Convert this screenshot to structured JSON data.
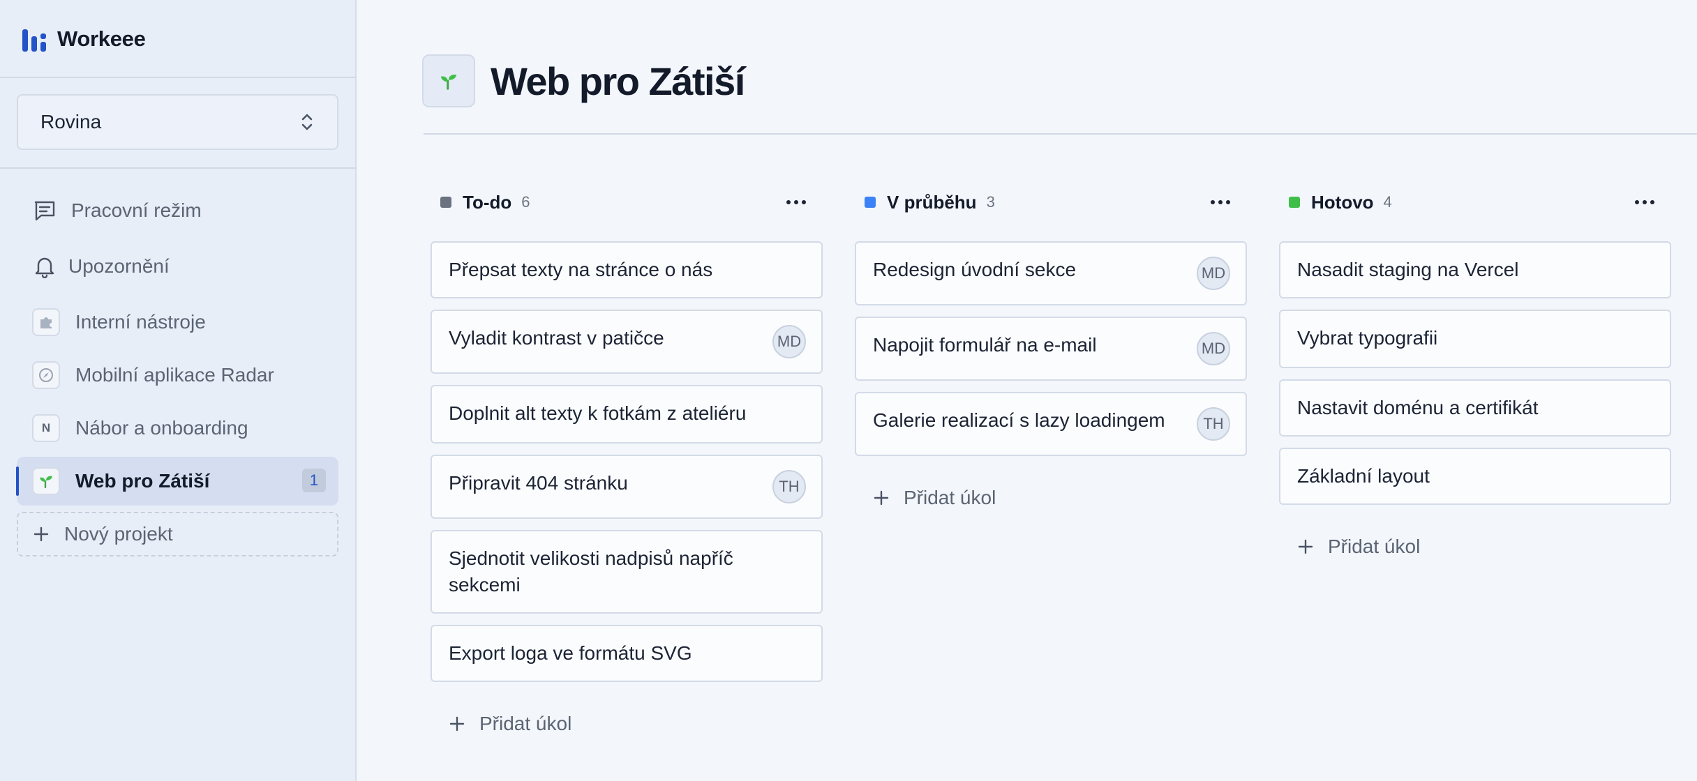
{
  "app": {
    "name": "Workeee"
  },
  "colors": {
    "accent": "#2453c7",
    "todo": "#6b7280",
    "in_progress": "#3b82f6",
    "done": "#3fbf4a"
  },
  "sidebar": {
    "workspace": "Rovina",
    "nav": [
      {
        "label": "Pracovní režim",
        "icon": "message-square-icon"
      },
      {
        "label": "Upozornění",
        "icon": "bell-icon"
      }
    ],
    "projects": [
      {
        "label": "Interní nástroje",
        "icon": "puzzle-icon"
      },
      {
        "label": "Mobilní aplikace Radar",
        "icon": "compass-icon"
      },
      {
        "label": "Nábor a onboarding",
        "icon_letter": "N"
      },
      {
        "label": "Web pro Zátiší",
        "icon": "sprout-icon",
        "badge": "1",
        "active": true
      }
    ],
    "new_project": "Nový projekt"
  },
  "page": {
    "title": "Web pro Zátiší",
    "icon": "sprout-icon"
  },
  "board": {
    "add_task_label": "Přidat úkol",
    "columns": [
      {
        "name": "To-do",
        "count": "6",
        "cards": [
          {
            "title": "Přepsat texty na stránce o nás"
          },
          {
            "title": "Vyladit kontrast v patičce",
            "assignee": "MD"
          },
          {
            "title": "Doplnit alt texty k fotkám z ateliéru"
          },
          {
            "title": "Připravit 404 stránku",
            "assignee": "TH"
          },
          {
            "title": "Sjednotit velikosti nadpisů napříč sekcemi"
          },
          {
            "title": "Export loga ve formátu SVG"
          }
        ]
      },
      {
        "name": "V průběhu",
        "count": "3",
        "cards": [
          {
            "title": "Redesign úvodní sekce",
            "assignee": "MD"
          },
          {
            "title": "Napojit formulář na e-mail",
            "assignee": "MD"
          },
          {
            "title": "Galerie realizací s lazy loadingem",
            "assignee": "TH"
          }
        ]
      },
      {
        "name": "Hotovo",
        "count": "4",
        "cards": [
          {
            "title": "Nasadit staging na Vercel"
          },
          {
            "title": "Vybrat typografii"
          },
          {
            "title": "Nastavit doménu a certifikát"
          },
          {
            "title": "Základní layout"
          }
        ]
      }
    ]
  }
}
